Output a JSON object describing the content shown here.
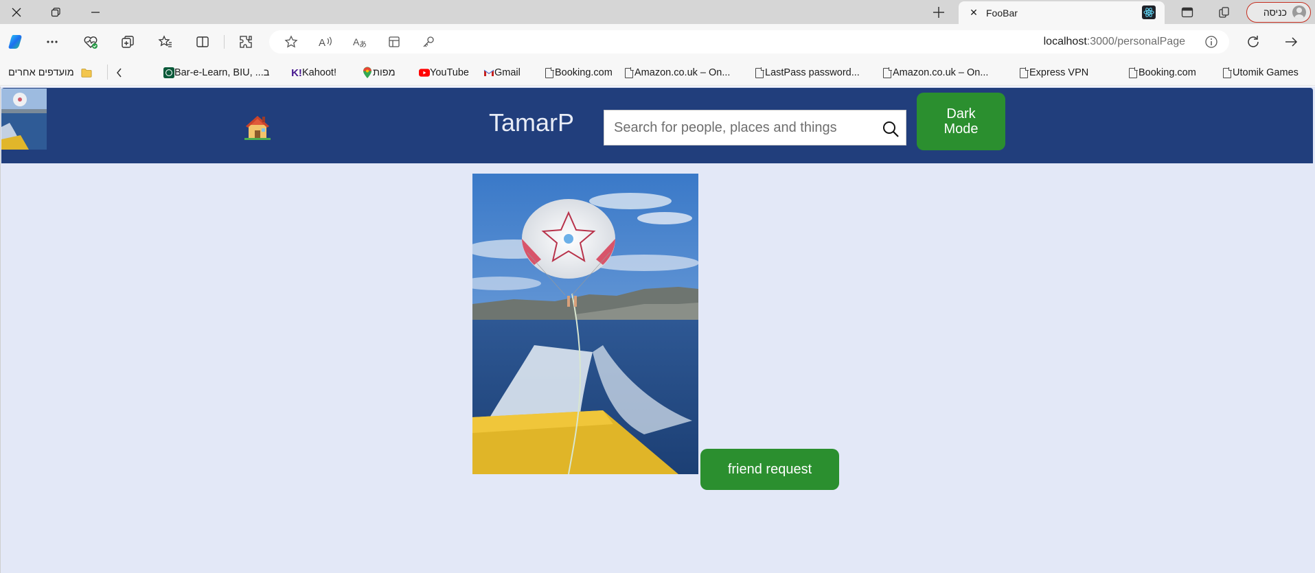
{
  "browser": {
    "tab": {
      "title": "FooBar",
      "close_icon": "close-icon"
    },
    "profile": {
      "label": "כניסה"
    },
    "address": {
      "host": "localhost",
      "rest": ":3000/personalPage"
    },
    "bookmarks": [
      {
        "label": "Utomik Games",
        "icon": "file-icon"
      },
      {
        "label": "Booking.com",
        "icon": "file-icon"
      },
      {
        "label": "Express VPN",
        "icon": "file-icon"
      },
      {
        "label": "Amazon.co.uk – On...",
        "icon": "file-icon"
      },
      {
        "label": "LastPass password...",
        "icon": "file-icon"
      },
      {
        "label": "Amazon.co.uk – On...",
        "icon": "file-icon"
      },
      {
        "label": "Booking.com",
        "icon": "file-icon"
      },
      {
        "label": "Gmail",
        "icon": "gmail-icon"
      },
      {
        "label": "YouTube",
        "icon": "youtube-icon"
      },
      {
        "label": "מפות",
        "icon": "maps-icon"
      },
      {
        "label": "Kahoot!",
        "icon": "kahoot-icon"
      },
      {
        "label": "Bar-e-Learn, BIU, ...ב",
        "icon": "barilan-icon"
      }
    ],
    "other_favorites": "מועדפים אחרים"
  },
  "page": {
    "navbar": {
      "username": "TamarP",
      "search_placeholder": "Search for people, places and things",
      "dark_mode_label": "Dark Mode"
    },
    "friend_request_label": "friend request"
  },
  "colors": {
    "navbar_bg": "#213e7c",
    "page_bg": "#e3e8f7",
    "button_green": "#2b8f2f"
  }
}
